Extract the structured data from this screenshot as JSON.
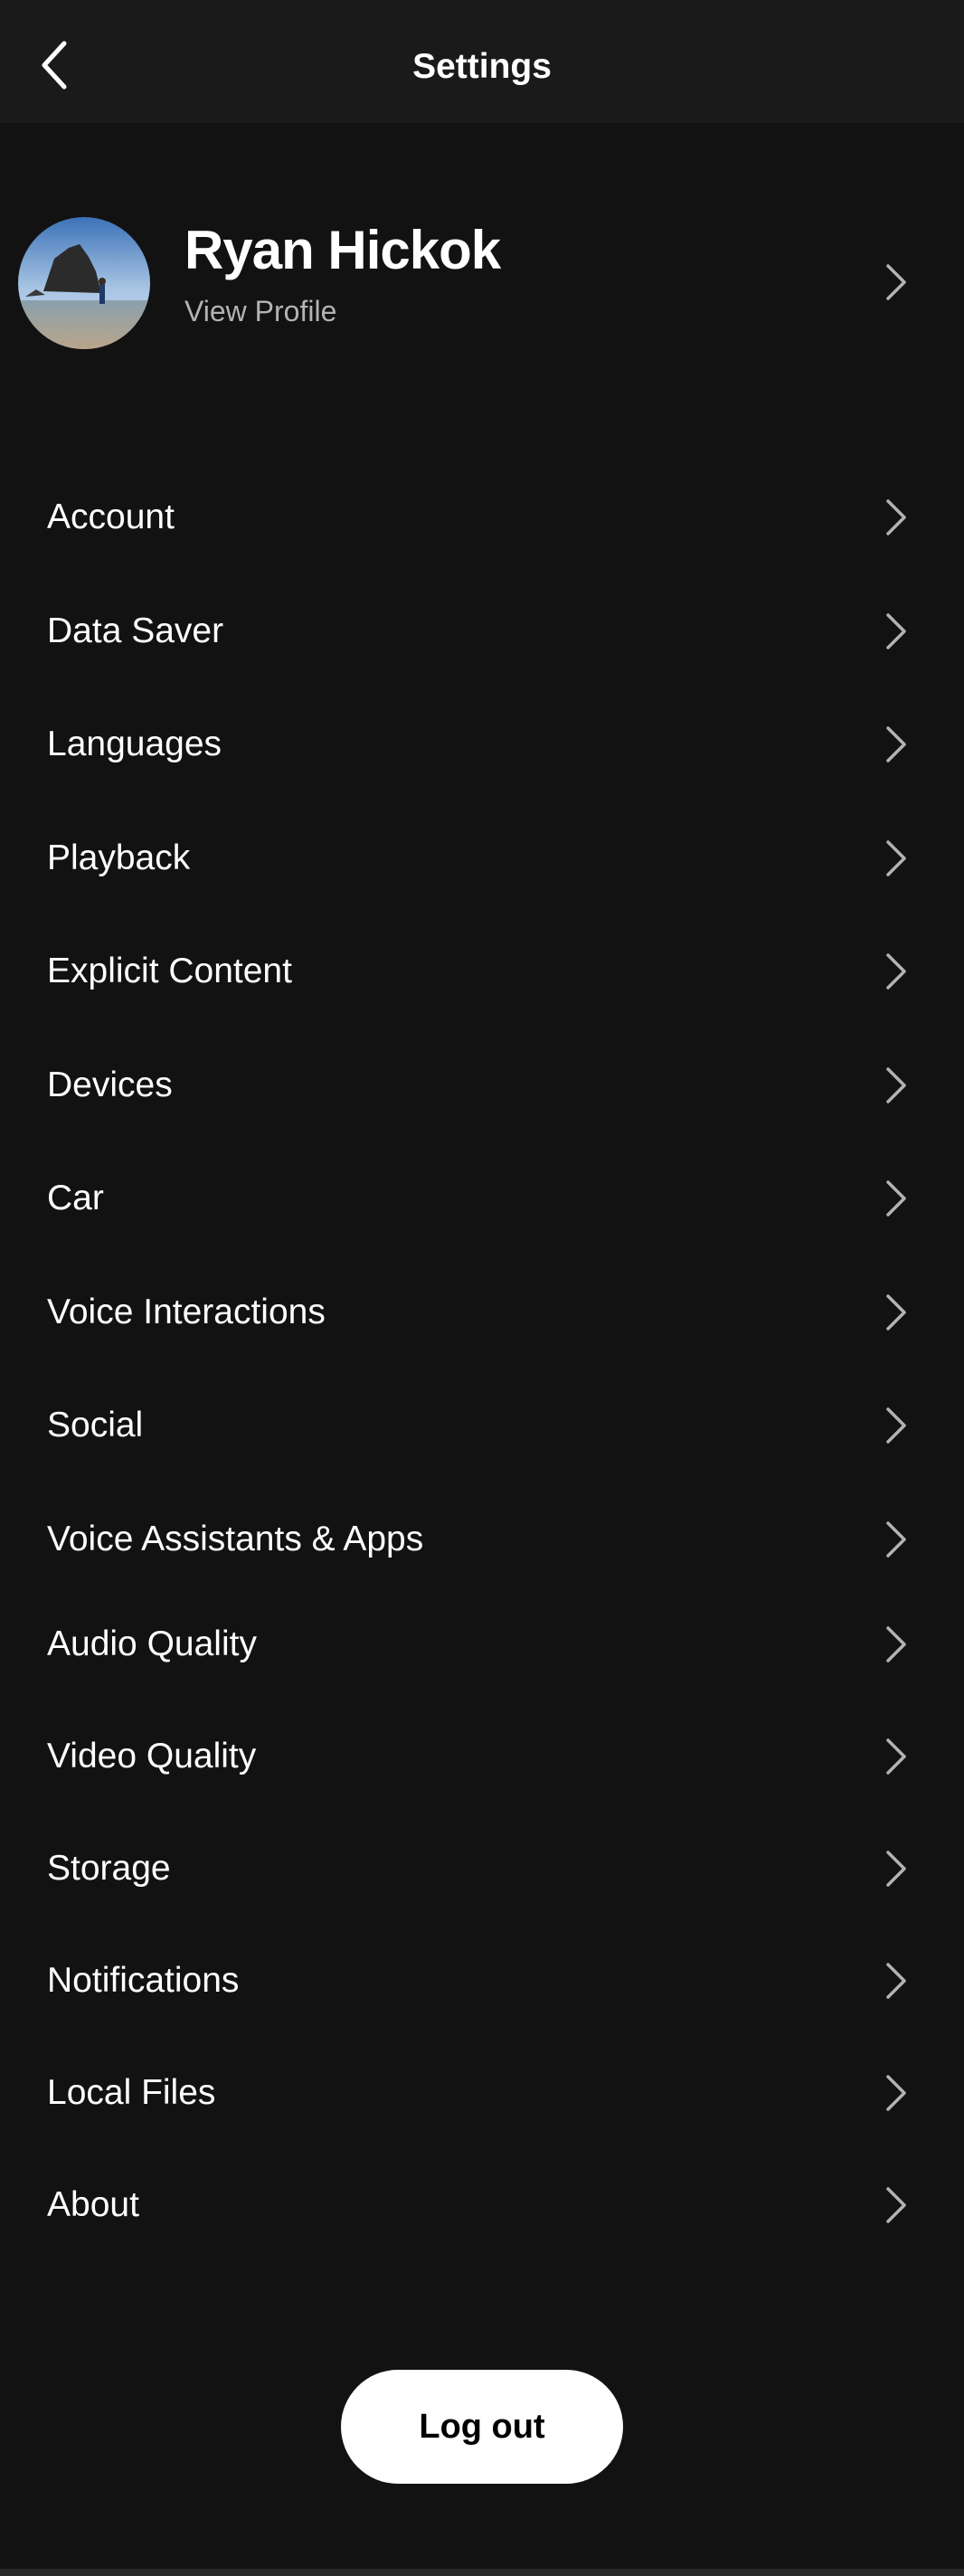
{
  "header": {
    "title": "Settings",
    "back_icon": "chevron-left-icon"
  },
  "profile": {
    "name": "Ryan Hickok",
    "link_label": "View Profile"
  },
  "menu": [
    {
      "label": "Account"
    },
    {
      "label": "Data Saver"
    },
    {
      "label": "Languages"
    },
    {
      "label": "Playback"
    },
    {
      "label": "Explicit Content"
    },
    {
      "label": "Devices"
    },
    {
      "label": "Car"
    },
    {
      "label": "Voice Interactions"
    },
    {
      "label": "Social"
    },
    {
      "label": "Voice Assistants & Apps"
    },
    {
      "label": "Audio Quality"
    },
    {
      "label": "Video Quality"
    },
    {
      "label": "Storage"
    },
    {
      "label": "Notifications"
    },
    {
      "label": "Local Files"
    },
    {
      "label": "About"
    }
  ],
  "logout": {
    "label": "Log out"
  },
  "colors": {
    "background": "#121212",
    "header": "#1a1a1a",
    "text": "#ffffff",
    "subtext": "#b3b3b3",
    "chevron": "#b3b3b3"
  }
}
